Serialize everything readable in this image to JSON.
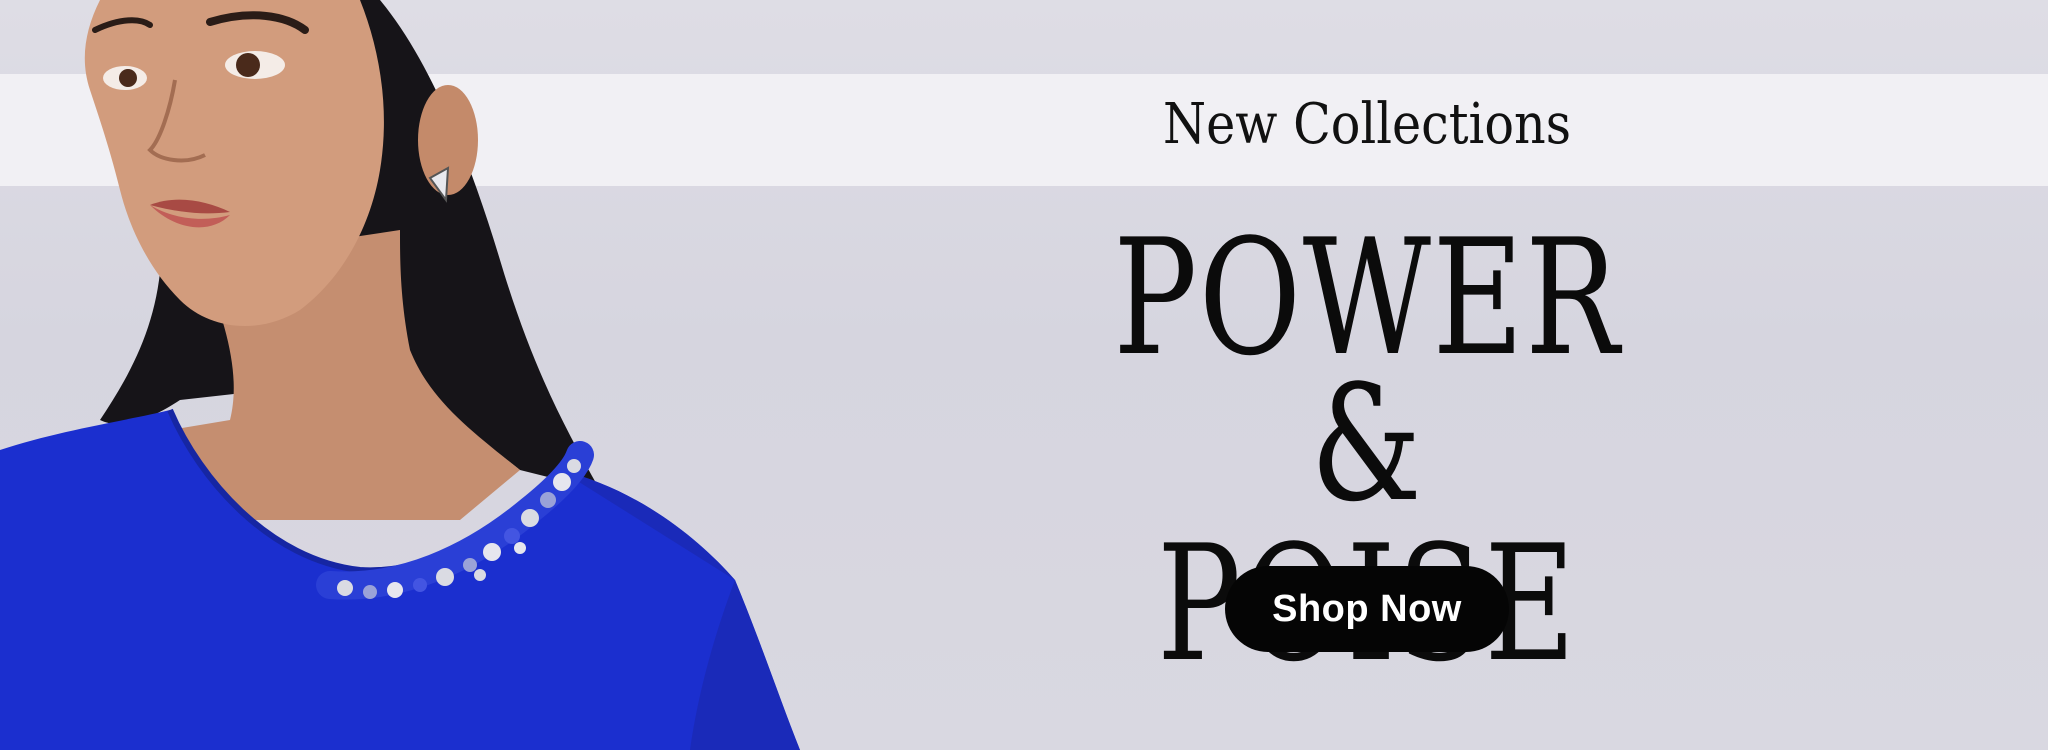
{
  "hero": {
    "tagline": "New Collections",
    "headline_line1": "POWER",
    "headline_line2": "& POISE",
    "cta_label": "Shop Now"
  },
  "colors": {
    "background": "#d9d8e1",
    "band": "#f1f0f4",
    "dress": "#1b2fcf",
    "button": "#050505",
    "button_text": "#ffffff"
  }
}
